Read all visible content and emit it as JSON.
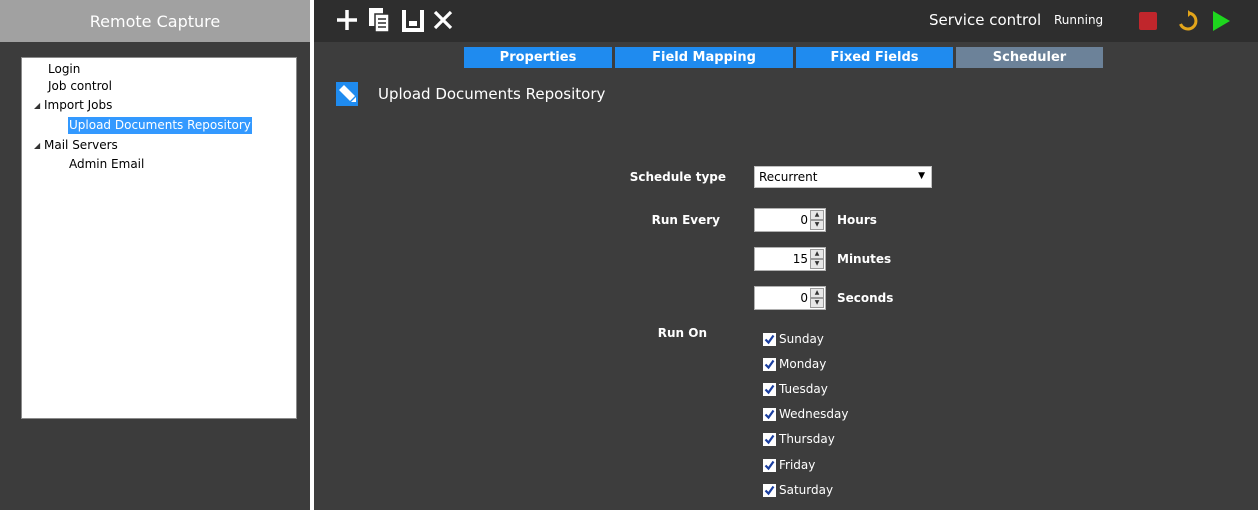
{
  "app": {
    "title": "Remote Capture"
  },
  "tree": {
    "items": [
      {
        "label": "Login",
        "level": 0,
        "expanded": null,
        "selected": false
      },
      {
        "label": "Job control",
        "level": 0,
        "expanded": null,
        "selected": false
      },
      {
        "label": "Import Jobs",
        "level": 0,
        "expanded": true,
        "selected": false
      },
      {
        "label": "Upload Documents Repository",
        "level": 1,
        "expanded": null,
        "selected": true
      },
      {
        "label": "Mail Servers",
        "level": 0,
        "expanded": true,
        "selected": false
      },
      {
        "label": "Admin Email",
        "level": 1,
        "expanded": null,
        "selected": false
      }
    ]
  },
  "toolbar": {
    "icons": [
      "add-icon",
      "copy-icon",
      "save-icon",
      "delete-icon"
    ]
  },
  "service": {
    "label": "Service control",
    "status": "Running",
    "icons": [
      "stop-icon",
      "restart-icon",
      "start-icon"
    ],
    "colors": {
      "stop": "#c0262c",
      "restart": "#e3a51a",
      "start": "#1ed61e"
    }
  },
  "tabs": [
    {
      "label": "Properties",
      "active": false
    },
    {
      "label": "Field Mapping",
      "active": false
    },
    {
      "label": "Fixed Fields",
      "active": false
    },
    {
      "label": "Scheduler",
      "active": true
    }
  ],
  "page": {
    "title": "Upload Documents Repository",
    "icon": "edit-icon"
  },
  "form": {
    "schedule_type_label": "Schedule type",
    "schedule_type_value": "Recurrent",
    "run_every_label": "Run Every",
    "run_every": [
      {
        "value": "0",
        "unit": "Hours"
      },
      {
        "value": "15",
        "unit": "Minutes"
      },
      {
        "value": "0",
        "unit": "Seconds"
      }
    ],
    "run_on_label": "Run On",
    "days": [
      {
        "label": "Sunday",
        "checked": true
      },
      {
        "label": "Monday",
        "checked": true
      },
      {
        "label": "Tuesday",
        "checked": true
      },
      {
        "label": "Wednesday",
        "checked": true
      },
      {
        "label": "Thursday",
        "checked": true
      },
      {
        "label": "Friday",
        "checked": true
      },
      {
        "label": "Saturday",
        "checked": true
      }
    ]
  },
  "colors": {
    "accent": "#1f8bef",
    "active_tab": "#6c8299",
    "selection": "#3399ff"
  }
}
